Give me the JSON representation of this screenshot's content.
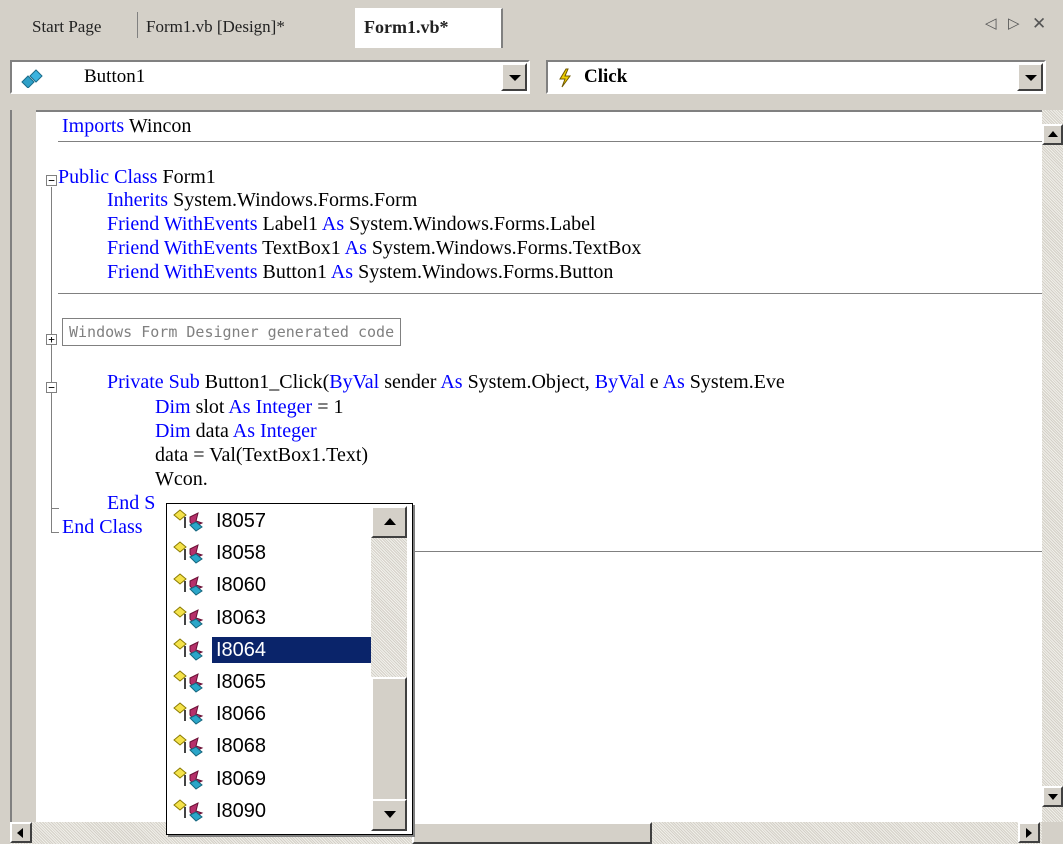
{
  "tabs": [
    {
      "label": "Start Page",
      "active": false
    },
    {
      "label": "Form1.vb [Design]*",
      "active": false
    },
    {
      "label": "Form1.vb*",
      "active": true
    }
  ],
  "tab_controls": {
    "prev": "◁",
    "next": "▷",
    "close": "✕"
  },
  "class_combo": {
    "value": "Button1",
    "icon": "class-member-icon"
  },
  "method_combo": {
    "value": "Click",
    "icon": "event-lightning-icon"
  },
  "code": {
    "imports": {
      "kw": "Imports",
      "rest": " Wincon"
    },
    "class_decl": {
      "kw": "Public Class",
      "rest": " Form1"
    },
    "inherits": {
      "kw": "Inherits",
      "rest": " System.Windows.Forms.Form"
    },
    "field1": {
      "kw1": "Friend WithEvents",
      "mid": " Label1 ",
      "kw2": "As",
      "rest": " System.Windows.Forms.Label"
    },
    "field2": {
      "kw1": "Friend WithEvents",
      "mid": " TextBox1 ",
      "kw2": "As",
      "rest": " System.Windows.Forms.TextBox"
    },
    "field3": {
      "kw1": "Friend WithEvents",
      "mid": " Button1 ",
      "kw2": "As",
      "rest": " System.Windows.Forms.Button"
    },
    "region": "Windows Form Designer generated code",
    "sub_decl": {
      "kw1": "Private Sub",
      "p1": " Button1_Click(",
      "kw2": "ByVal",
      "p2": " sender ",
      "kw3": "As",
      "p3": " System.Object, ",
      "kw4": "ByVal",
      "p4": " e ",
      "kw5": "As",
      "p5": " System.Eve"
    },
    "dim1": {
      "kw1": "Dim",
      "p1": " slot ",
      "kw2": "As Integer",
      "p2": " = 1"
    },
    "dim2": {
      "kw1": "Dim",
      "p1": " data ",
      "kw2": "As Integer"
    },
    "assign": "data = Val(TextBox1.Text)",
    "partial": "Wcon.",
    "end_sub": "End S",
    "end_class": "End Class"
  },
  "intellisense": {
    "items": [
      "I8057",
      "I8058",
      "I8060",
      "I8063",
      "I8064",
      "I8065",
      "I8066",
      "I8068",
      "I8069",
      "I8090"
    ],
    "selected": "I8064",
    "item_icon": "constant-field-icon"
  },
  "colors": {
    "keyword": "#0000ff",
    "selection": "#0a246a",
    "chrome": "#d4d0c8"
  }
}
